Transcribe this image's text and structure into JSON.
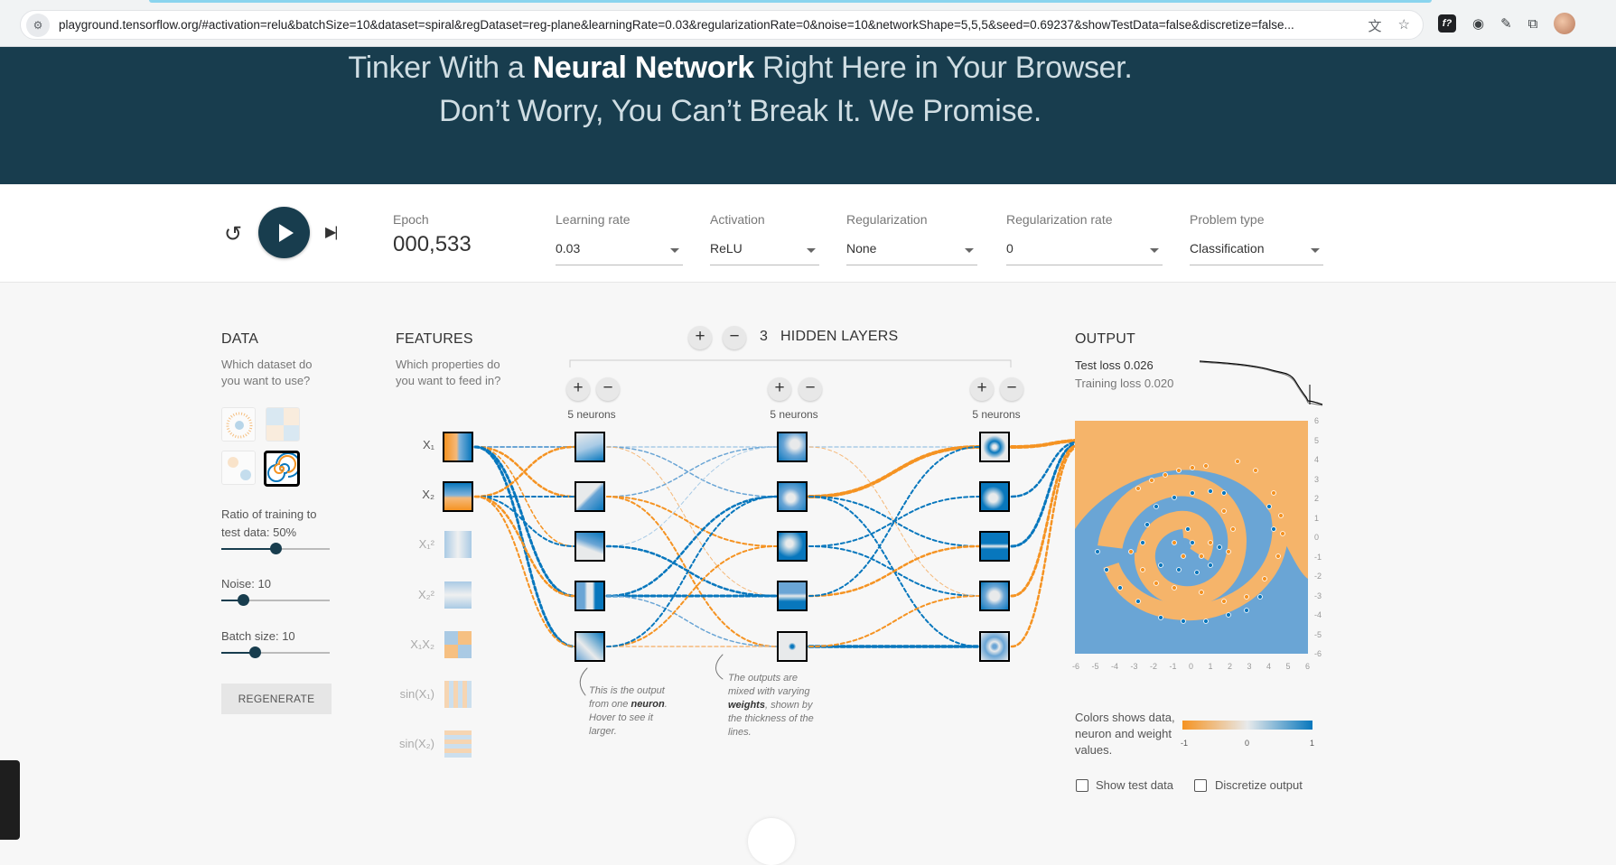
{
  "browser": {
    "url": "playground.tensorflow.org/#activation=relu&batchSize=10&dataset=spiral&regDataset=reg-plane&learningRate=0.03&regularizationRate=0&noise=10&networkShape=5,5,5&seed=0.69237&showTestData=false&discretize=false..."
  },
  "hero": {
    "line1_pre": "Tinker With a ",
    "line1_bold": "Neural Network",
    "line1_post": " Right Here in Your Browser.",
    "line2": "Don’t Worry, You Can’t Break It. We Promise."
  },
  "controls": {
    "epoch_label": "Epoch",
    "epoch_value": "000,533",
    "learning_rate": {
      "label": "Learning rate",
      "value": "0.03"
    },
    "activation": {
      "label": "Activation",
      "value": "ReLU"
    },
    "regularization": {
      "label": "Regularization",
      "value": "None"
    },
    "regularization_rate": {
      "label": "Regularization rate",
      "value": "0"
    },
    "problem_type": {
      "label": "Problem type",
      "value": "Classification"
    }
  },
  "data_panel": {
    "title": "DATA",
    "subtitle": "Which dataset do you want to use?",
    "ratio_label": "Ratio of training to test data:  50%",
    "ratio_fraction": 0.5,
    "noise_label": "Noise:  10",
    "noise_fraction": 0.2,
    "batch_label": "Batch size:  10",
    "batch_fraction": 0.31,
    "regenerate": "REGENERATE"
  },
  "features": {
    "title": "FEATURES",
    "subtitle": "Which properties do you want to feed in?",
    "items": [
      {
        "label": "X₁",
        "active": true
      },
      {
        "label": "X₂",
        "active": true
      },
      {
        "label": "X₁²",
        "active": false
      },
      {
        "label": "X₂²",
        "active": false
      },
      {
        "label": "X₁X₂",
        "active": false
      },
      {
        "label": "sin(X₁)",
        "active": false
      },
      {
        "label": "sin(X₂)",
        "active": false
      }
    ]
  },
  "network": {
    "count": "3",
    "hidden_layers_label": "HIDDEN LAYERS",
    "layers": [
      {
        "label": "5 neurons"
      },
      {
        "label": "5 neurons"
      },
      {
        "label": "5 neurons"
      }
    ],
    "annotation1": {
      "pre": "This is the output from one ",
      "bold": "neuron",
      "post": ". Hover to see it larger."
    },
    "annotation2": {
      "pre": "The outputs are mixed with varying ",
      "bold": "weights",
      "post": ", shown by the thickness of the lines."
    }
  },
  "output": {
    "title": "OUTPUT",
    "test_loss": "Test loss 0.026",
    "training_loss": "Training loss 0.020",
    "legend_text": "Colors shows data, neuron and weight values.",
    "colorbar_ticks": [
      "-1",
      "0",
      "1"
    ],
    "x_ticks": [
      "-6",
      "-5",
      "-4",
      "-3",
      "-2",
      "-1",
      "0",
      "1",
      "2",
      "3",
      "4",
      "5",
      "6"
    ],
    "y_ticks": [
      "6",
      "5",
      "4",
      "3",
      "2",
      "1",
      "0",
      "-1",
      "-2",
      "-3",
      "-4",
      "-5",
      "-6"
    ],
    "show_test_data": "Show test data",
    "discretize_output": "Discretize output"
  },
  "colors": {
    "orange": "#f59322",
    "blue": "#0877bd",
    "dark": "#183d4e"
  }
}
